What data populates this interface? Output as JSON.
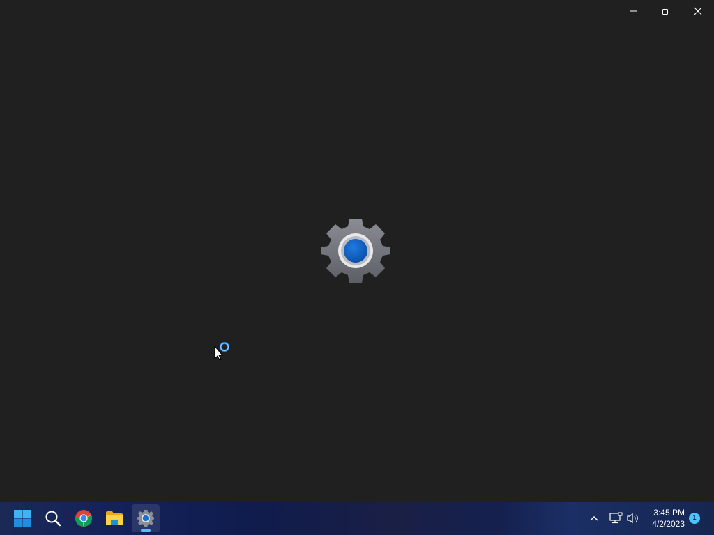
{
  "window": {
    "title_buttons": {
      "minimize_icon": "minimize-icon",
      "restore_icon": "restore-icon",
      "close_icon": "close-icon"
    },
    "splash": {
      "icon": "settings-gear-icon",
      "accent_color": "#0a5cbd"
    }
  },
  "taskbar": {
    "apps": [
      {
        "name": "start-button",
        "icon": "windows-logo-icon"
      },
      {
        "name": "search-button",
        "icon": "search-icon"
      },
      {
        "name": "chrome-app",
        "icon": "chrome-icon"
      },
      {
        "name": "file-explorer-app",
        "icon": "folder-icon"
      },
      {
        "name": "settings-app",
        "icon": "settings-gear-icon",
        "active": true
      }
    ],
    "tray": {
      "overflow_icon": "chevron-up-icon",
      "network_icon": "network-icon",
      "volume_icon": "volume-icon",
      "time": "3:45 PM",
      "date": "4/2/2023",
      "notification_count": "1"
    },
    "accent_color": "#4cc2ff"
  }
}
